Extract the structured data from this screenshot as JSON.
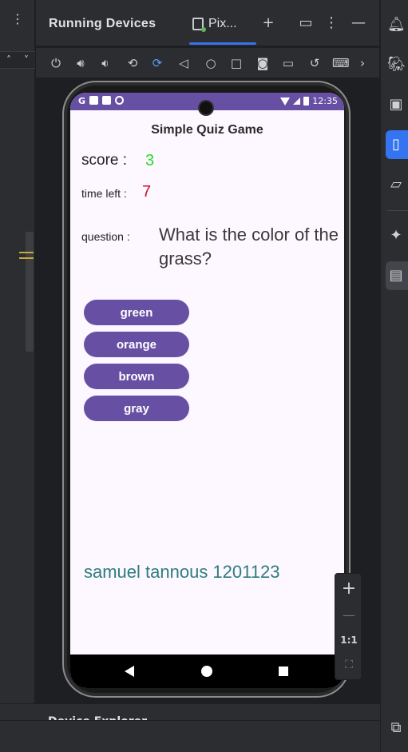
{
  "ide": {
    "panel_title": "Running Devices",
    "tab_label": "Pix...",
    "zoom_ratio": "1:1",
    "bottom_panel_title": "Device Explorer"
  },
  "app": {
    "title": "Simple Quiz Game",
    "score_label": "score :",
    "score_value": "3",
    "time_label": "time left :",
    "time_value": "7",
    "question_label": "question :",
    "question_text": "What is the color of the grass?",
    "answers": [
      "green",
      "orange",
      "brown",
      "gray"
    ],
    "author": "samuel tannous 1201123"
  },
  "status_bar": {
    "time": "12:35",
    "app_icons": [
      "G"
    ]
  },
  "colors": {
    "accent": "#6750a4",
    "score": "#22dd22",
    "time_left": "#cc1133",
    "author": "#2e7d7d",
    "ide_selection": "#3574f0"
  }
}
